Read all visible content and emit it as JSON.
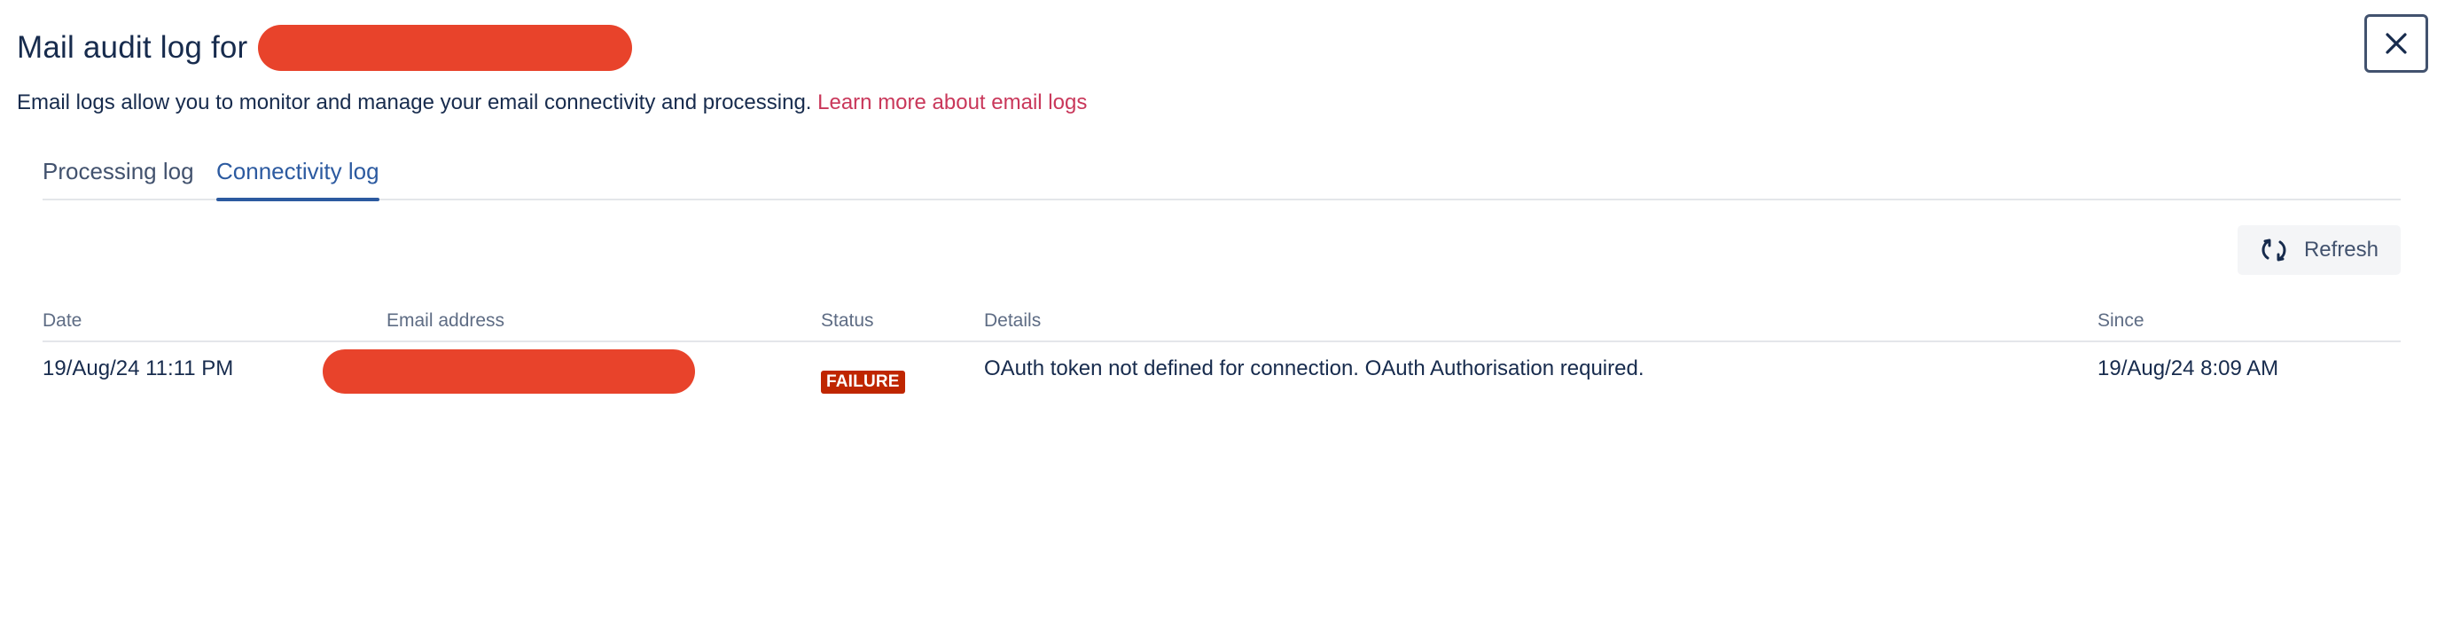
{
  "dialog": {
    "title": "Mail audit log for",
    "subtitle": "Email logs allow you to monitor and manage your email connectivity and processing.",
    "learn_more": "Learn more about email logs"
  },
  "tabs": [
    {
      "label": "Processing log",
      "active": false
    },
    {
      "label": "Connectivity log",
      "active": true
    }
  ],
  "toolbar": {
    "refresh_label": "Refresh"
  },
  "table": {
    "headers": [
      "Date",
      "Email address",
      "Status",
      "Details",
      "Since"
    ],
    "rows": [
      {
        "date": "19/Aug/24 11:11 PM",
        "status": "FAILURE",
        "details": "OAuth token not defined for connection. OAuth Authorisation required.",
        "since": "19/Aug/24 8:09 AM"
      }
    ]
  },
  "colors": {
    "link": "#c9375a",
    "active_tab": "#2c5aa0",
    "failure_badge": "#bf2600",
    "redaction": "#e8432b"
  },
  "icons": {
    "close": "close-icon",
    "refresh": "refresh-icon"
  }
}
